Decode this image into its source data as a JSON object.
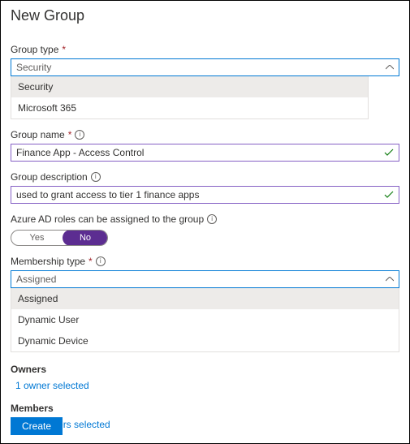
{
  "title": "New Group",
  "fields": {
    "group_type": {
      "label": "Group type",
      "required": true,
      "value": "Security",
      "options": [
        "Security",
        "Microsoft 365"
      ]
    },
    "group_name": {
      "label": "Group name",
      "required": true,
      "info": true,
      "value": "Finance App - Access Control"
    },
    "group_description": {
      "label": "Group description",
      "info": true,
      "value": "used to grant access to tier 1 finance apps"
    },
    "ad_roles": {
      "label": "Azure AD roles can be assigned to the group",
      "info": true,
      "yes_label": "Yes",
      "no_label": "No",
      "value": "No"
    },
    "membership_type": {
      "label": "Membership type",
      "required": true,
      "info": true,
      "value": "Assigned",
      "options": [
        "Assigned",
        "Dynamic User",
        "Dynamic Device"
      ]
    }
  },
  "sections": {
    "owners": {
      "label": "Owners",
      "link": "1 owner selected"
    },
    "members": {
      "label": "Members",
      "link": "No members selected"
    }
  },
  "buttons": {
    "create": "Create"
  },
  "colors": {
    "primary": "#0078d4",
    "purple": "#5c2d91",
    "input_border": "#8661c5"
  }
}
